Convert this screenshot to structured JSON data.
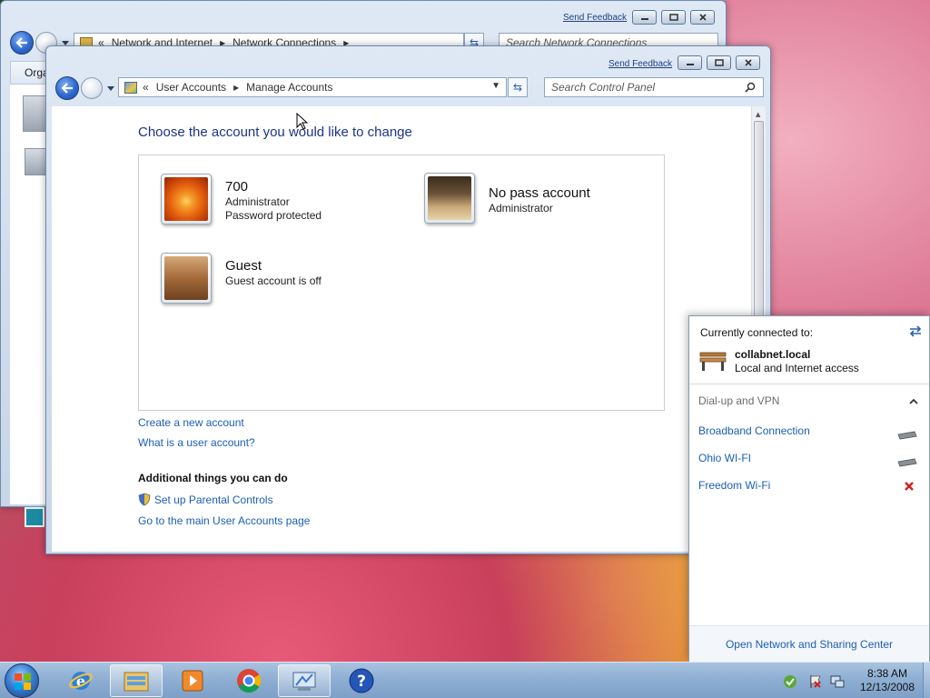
{
  "back_window": {
    "send_feedback": "Send Feedback",
    "breadcrumb": [
      "Network and Internet",
      "Network Connections"
    ],
    "search_placeholder": "Search Network Connections",
    "toolbar_organize": "Orga"
  },
  "main_window": {
    "send_feedback": "Send Feedback",
    "breadcrumb_prefix": "«",
    "breadcrumb": [
      "User Accounts",
      "Manage Accounts"
    ],
    "search_placeholder": "Search Control Panel",
    "heading": "Choose the account you would like to change",
    "accounts": [
      {
        "name": "700",
        "lines": [
          "Administrator",
          "Password protected"
        ],
        "picture": "orange-flower"
      },
      {
        "name": "No pass account",
        "lines": [
          "Administrator"
        ],
        "picture": "chess-pieces"
      },
      {
        "name": "Guest",
        "lines": [
          "Guest account is off"
        ],
        "picture": "briefcase"
      }
    ],
    "links": [
      "Create a new account",
      "What is a user account?"
    ],
    "additional_heading": "Additional things you can do",
    "additional_links": [
      "Set up Parental Controls",
      "Go to the main User Accounts page"
    ]
  },
  "network_flyout": {
    "connected_label": "Currently connected to:",
    "network_name": "collabnet.local",
    "network_access": "Local and Internet access",
    "section_label": "Dial-up and VPN",
    "connections": [
      {
        "name": "Broadband Connection",
        "status": "available"
      },
      {
        "name": "Ohio WI-FI",
        "status": "available"
      },
      {
        "name": "Freedom Wi-Fi",
        "status": "disconnected"
      }
    ],
    "footer_link": "Open Network and Sharing Center"
  },
  "taskbar": {
    "time": "8:38 AM",
    "date": "12/13/2008",
    "pinned": [
      "start-orb",
      "internet-explorer-icon",
      "windows-explorer-icon",
      "media-player-icon",
      "chrome-icon",
      "control-panel-icon",
      "help-icon"
    ]
  },
  "colors": {
    "link": "#1a5fb4",
    "heading": "#1e3287",
    "error_red": "#d41e1e"
  }
}
